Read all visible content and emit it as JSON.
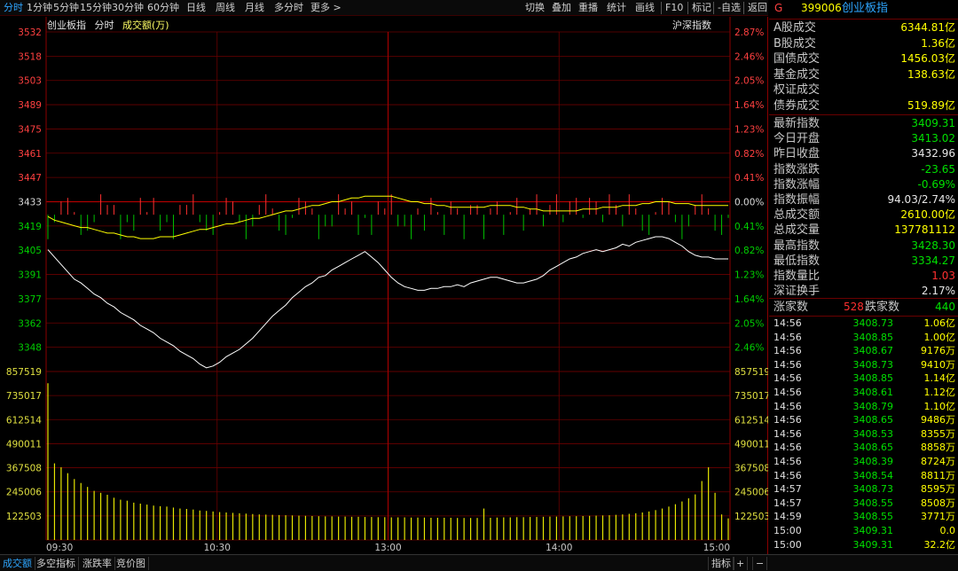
{
  "toolbar": {
    "left": [
      "分时",
      "1分钟",
      "5分钟",
      "15分钟",
      "30分钟",
      "60分钟",
      "日线",
      "周线",
      "月线",
      "多分时",
      "更多 >"
    ],
    "right": [
      "切换",
      "叠加",
      "重播",
      "统计",
      "画线",
      "F10",
      "标记",
      "-自选",
      "返回"
    ]
  },
  "chart_header": {
    "name": "创业板指",
    "mode": "分时",
    "volume_label": "成交额(万)",
    "compare": "沪深指数"
  },
  "price_axis": {
    "left": [
      "3532",
      "3518",
      "3503",
      "3489",
      "3475",
      "3461",
      "3447",
      "3433",
      "3419",
      "3405",
      "3391",
      "3377",
      "3362",
      "3348"
    ],
    "right": [
      "2.87%",
      "2.46%",
      "2.05%",
      "1.64%",
      "1.23%",
      "0.82%",
      "0.41%",
      "0.00%",
      "0.41%",
      "0.82%",
      "1.23%",
      "1.64%",
      "2.05%",
      "2.46%"
    ]
  },
  "volume_axis": [
    "857519",
    "735017",
    "612514",
    "490011",
    "367508",
    "245006",
    "122503"
  ],
  "time_axis": [
    "09:30",
    "10:30",
    "13:00",
    "14:00",
    "15:00"
  ],
  "bottom_tabs": [
    "成交额",
    "多空指标",
    "涨跌率",
    "竞价图"
  ],
  "bottom_right": [
    "指标",
    "+",
    "−"
  ],
  "side": {
    "badge": "G",
    "code": "399006",
    "name": "创业板指",
    "stats": [
      {
        "label": "A股成交",
        "value": "6344.81亿",
        "color": "y"
      },
      {
        "label": "B股成交",
        "value": "1.36亿",
        "color": "y"
      },
      {
        "label": "国债成交",
        "value": "1456.03亿",
        "color": "y"
      },
      {
        "label": "基金成交",
        "value": "138.63亿",
        "color": "y"
      },
      {
        "label": "权证成交",
        "value": "",
        "color": "y"
      },
      {
        "label": "债券成交",
        "value": "519.89亿",
        "color": "y"
      }
    ],
    "stats2": [
      {
        "label": "最新指数",
        "value": "3409.31",
        "color": "g"
      },
      {
        "label": "今日开盘",
        "value": "3413.02",
        "color": "g"
      },
      {
        "label": "昨日收盘",
        "value": "3432.96",
        "color": "w"
      },
      {
        "label": "指数涨跌",
        "value": "-23.65",
        "color": "g"
      },
      {
        "label": "指数涨幅",
        "value": "-0.69%",
        "color": "g"
      },
      {
        "label": "指数振幅",
        "value": "94.03/2.74%",
        "color": "w"
      },
      {
        "label": "总成交额",
        "value": "2610.00亿",
        "color": "y"
      },
      {
        "label": "总成交量",
        "value": "137781112",
        "color": "y"
      },
      {
        "label": "最高指数",
        "value": "3428.30",
        "color": "g"
      },
      {
        "label": "最低指数",
        "value": "3334.27",
        "color": "g"
      },
      {
        "label": "指数量比",
        "value": "1.03",
        "color": "r"
      },
      {
        "label": "深证换手",
        "value": "2.17%",
        "color": "w"
      }
    ],
    "breadth": {
      "up_label": "涨家数",
      "up": "528",
      "down_label": "跌家数",
      "down": "440"
    },
    "ticks": [
      {
        "t": "14:56",
        "p": "3408.73",
        "v": "1.06亿"
      },
      {
        "t": "14:56",
        "p": "3408.85",
        "v": "1.00亿"
      },
      {
        "t": "14:56",
        "p": "3408.67",
        "v": "9176万"
      },
      {
        "t": "14:56",
        "p": "3408.73",
        "v": "9410万"
      },
      {
        "t": "14:56",
        "p": "3408.85",
        "v": "1.14亿"
      },
      {
        "t": "14:56",
        "p": "3408.61",
        "v": "1.12亿"
      },
      {
        "t": "14:56",
        "p": "3408.79",
        "v": "1.10亿"
      },
      {
        "t": "14:56",
        "p": "3408.65",
        "v": "9486万"
      },
      {
        "t": "14:56",
        "p": "3408.53",
        "v": "8355万"
      },
      {
        "t": "14:56",
        "p": "3408.65",
        "v": "8858万"
      },
      {
        "t": "14:56",
        "p": "3408.39",
        "v": "8724万"
      },
      {
        "t": "14:56",
        "p": "3408.54",
        "v": "8811万"
      },
      {
        "t": "14:57",
        "p": "3408.73",
        "v": "8595万"
      },
      {
        "t": "14:57",
        "p": "3408.55",
        "v": "8508万"
      },
      {
        "t": "14:59",
        "p": "3408.55",
        "v": "3771万"
      },
      {
        "t": "15:00",
        "p": "3409.31",
        "v": "0.0"
      },
      {
        "t": "15:00",
        "p": "3409.31",
        "v": "32.2亿"
      }
    ]
  },
  "chart_data": {
    "type": "line",
    "prev_close": 3432.96,
    "ylim": [
      3348,
      3532
    ],
    "price_series": [
      3414,
      3410,
      3406,
      3402,
      3398,
      3396,
      3393,
      3390,
      3388,
      3385,
      3383,
      3380,
      3378,
      3376,
      3373,
      3371,
      3369,
      3366,
      3364,
      3362,
      3359,
      3357,
      3355,
      3352,
      3350,
      3351,
      3353,
      3356,
      3358,
      3360,
      3363,
      3366,
      3370,
      3374,
      3378,
      3381,
      3384,
      3388,
      3391,
      3394,
      3396,
      3399,
      3400,
      3403,
      3405,
      3407,
      3409,
      3411,
      3413,
      3410,
      3407,
      3403,
      3399,
      3396,
      3394,
      3393,
      3392,
      3392,
      3393,
      3393,
      3394,
      3394,
      3395,
      3394,
      3396,
      3397,
      3398,
      3399,
      3399,
      3398,
      3397,
      3396,
      3396,
      3397,
      3398,
      3400,
      3403,
      3405,
      3407,
      3409,
      3410,
      3412,
      3413,
      3414,
      3413,
      3414,
      3415,
      3417,
      3416,
      3418,
      3419,
      3420,
      3421,
      3421,
      3420,
      3418,
      3416,
      3413,
      3411,
      3410,
      3410,
      3409,
      3409,
      3409
    ],
    "avg_series": [
      3432,
      3430,
      3429,
      3428,
      3427,
      3426,
      3426,
      3425,
      3424,
      3423,
      3423,
      3422,
      3421,
      3421,
      3420,
      3420,
      3420,
      3421,
      3421,
      3421,
      3422,
      3423,
      3424,
      3425,
      3425,
      3426,
      3427,
      3428,
      3428,
      3429,
      3430,
      3431,
      3431,
      3432,
      3433,
      3434,
      3435,
      3435,
      3436,
      3437,
      3438,
      3438,
      3439,
      3440,
      3440,
      3441,
      3442,
      3442,
      3443,
      3443,
      3443,
      3443,
      3443,
      3442,
      3441,
      3440,
      3440,
      3439,
      3439,
      3438,
      3438,
      3437,
      3437,
      3437,
      3437,
      3437,
      3437,
      3438,
      3438,
      3438,
      3438,
      3437,
      3437,
      3436,
      3436,
      3435,
      3435,
      3435,
      3435,
      3435,
      3435,
      3436,
      3436,
      3436,
      3437,
      3437,
      3437,
      3438,
      3438,
      3438,
      3439,
      3439,
      3440,
      3440,
      3440,
      3439,
      3439,
      3439,
      3438,
      3438,
      3438,
      3438,
      3438,
      3438
    ],
    "volume_ylim": [
      0,
      857519
    ],
    "volume_series": [
      798000,
      390000,
      370000,
      340000,
      310000,
      290000,
      270000,
      250000,
      240000,
      230000,
      215000,
      205000,
      200000,
      190000,
      185000,
      180000,
      175000,
      172000,
      170000,
      165000,
      160000,
      158000,
      155000,
      150000,
      148000,
      145000,
      142000,
      140000,
      138000,
      136000,
      134000,
      132000,
      130000,
      129000,
      128000,
      127000,
      126000,
      125000,
      124000,
      123000,
      122000,
      121000,
      120000,
      120000,
      119000,
      119000,
      118000,
      118000,
      117000,
      117000,
      116000,
      116000,
      115000,
      115000,
      115000,
      114000,
      114000,
      114000,
      113000,
      113000,
      113000,
      113000,
      112000,
      112000,
      112000,
      112000,
      160000,
      113000,
      114000,
      115000,
      115000,
      116000,
      116000,
      117000,
      117000,
      118000,
      119000,
      119000,
      120000,
      121000,
      121000,
      122000,
      123000,
      124000,
      125000,
      126000,
      128000,
      130000,
      133000,
      136000,
      140000,
      145000,
      152000,
      160000,
      170000,
      182000,
      196000,
      212000,
      232000,
      300000,
      370000,
      240000,
      130000,
      110000
    ]
  }
}
